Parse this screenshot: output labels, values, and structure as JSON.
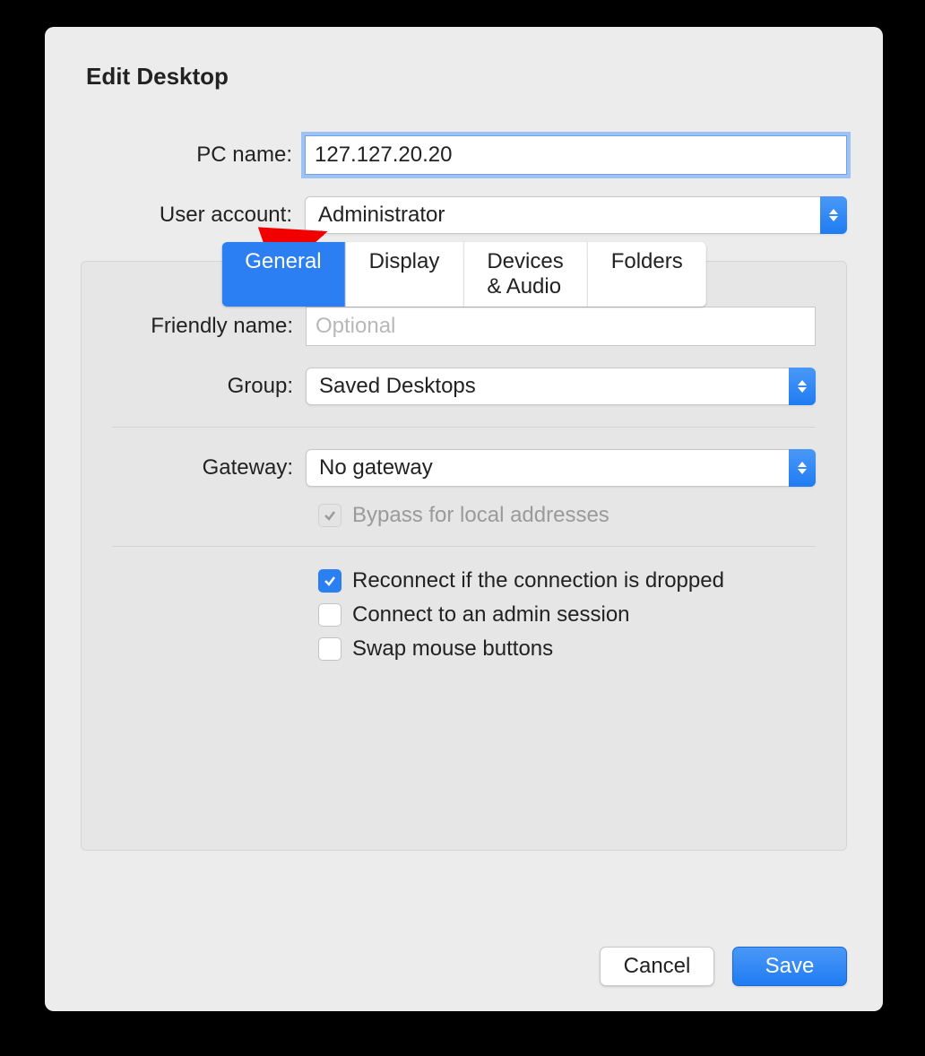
{
  "title": "Edit Desktop",
  "fields": {
    "pc_name": {
      "label": "PC name:",
      "value": "127.127.20.20"
    },
    "user_account": {
      "label": "User account:",
      "selected": "Administrator"
    }
  },
  "tabs": {
    "items": [
      "General",
      "Display",
      "Devices & Audio",
      "Folders"
    ],
    "active": "General"
  },
  "general": {
    "friendly_name": {
      "label": "Friendly name:",
      "value": "",
      "placeholder": "Optional"
    },
    "group": {
      "label": "Group:",
      "selected": "Saved Desktops"
    },
    "gateway": {
      "label": "Gateway:",
      "selected": "No gateway"
    },
    "bypass": {
      "label": "Bypass for local addresses",
      "checked": true,
      "disabled": true
    },
    "reconnect": {
      "label": "Reconnect if the connection is dropped",
      "checked": true
    },
    "admin_session": {
      "label": "Connect to an admin session",
      "checked": false
    },
    "swap_mouse": {
      "label": "Swap mouse buttons",
      "checked": false
    }
  },
  "buttons": {
    "cancel": "Cancel",
    "save": "Save"
  },
  "colors": {
    "accent": "#2b7ff2",
    "arrow": "#f20000"
  }
}
